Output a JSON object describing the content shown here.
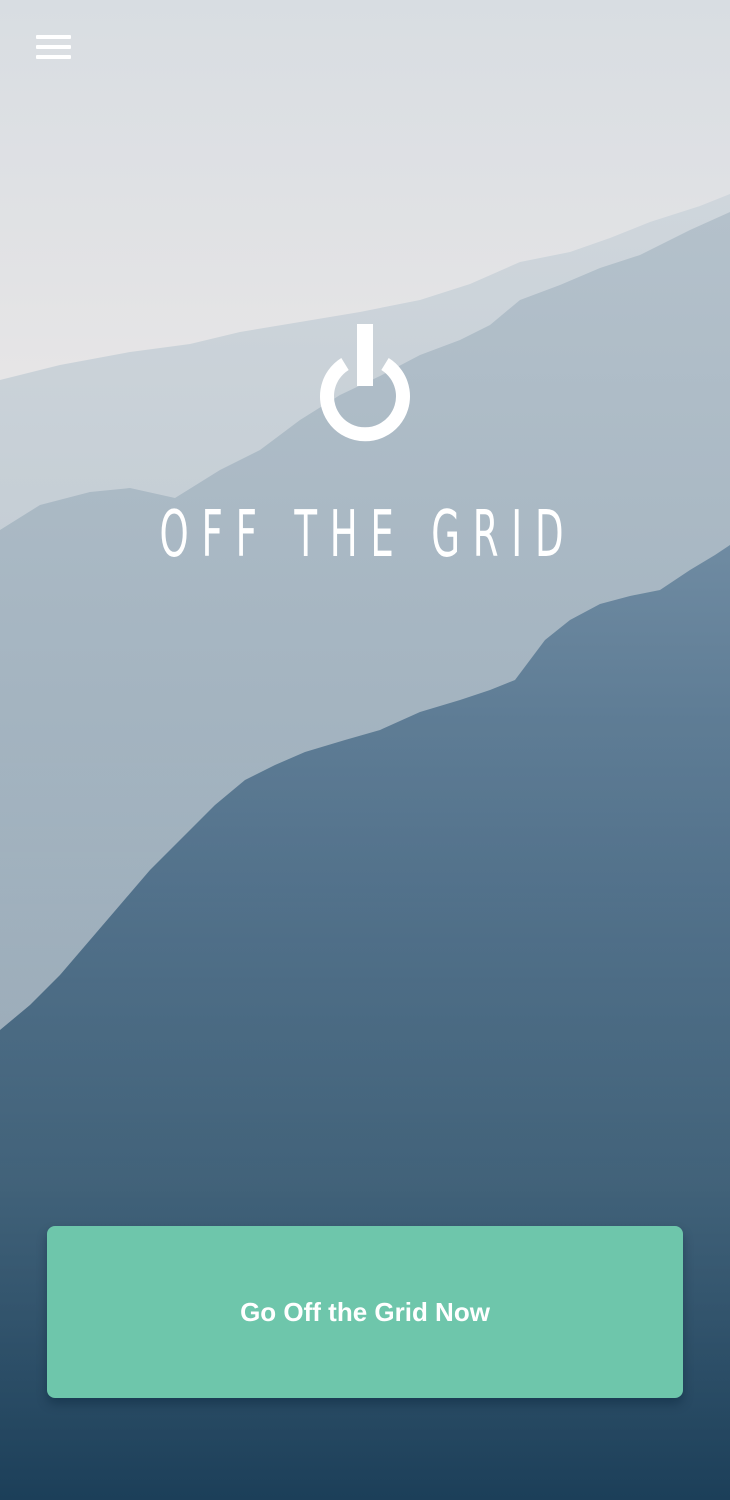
{
  "app": {
    "title": "OFF THE GRID"
  },
  "header": {
    "menu_icon": "hamburger-menu-icon"
  },
  "logo": {
    "icon": "power-icon"
  },
  "cta": {
    "label": "Go Off the Grid Now"
  },
  "colors": {
    "sky": "#e4e4e6",
    "mountain_far": "#c3cdd4",
    "mountain_mid": "#a7b6c2",
    "mountain_near": "#2b4f6b",
    "cta_background": "#6ec6ab",
    "text": "#ffffff"
  }
}
